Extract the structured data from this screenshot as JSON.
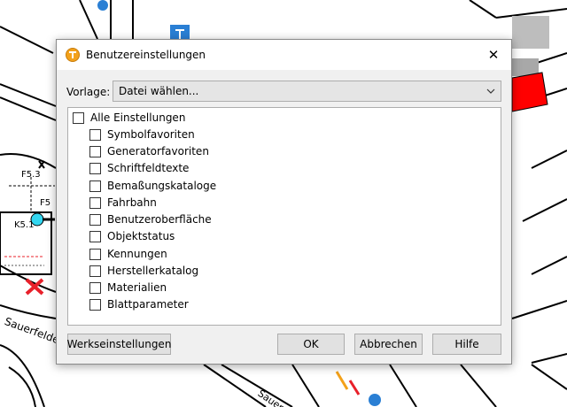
{
  "map": {
    "labels": [
      "F5.3",
      "F5",
      "K5.1",
      "Sauerfelde",
      "Sauer"
    ],
    "colors": {
      "red_block": "#ff0000",
      "grey_block": "#a8a8a8",
      "marker": "#33d6f0",
      "cross": "#e8202a",
      "sign": "#2a7fd4"
    }
  },
  "dialog": {
    "title": "Benutzereinstellungen",
    "app_icon": "app-logo-icon",
    "close_glyph": "✕",
    "vorlage_label": "Vorlage:",
    "vorlage_value": "Datei wählen...",
    "all_label": "Alle Einstellungen",
    "items": [
      "Symbolfavoriten",
      "Generatorfavoriten",
      "Schriftfeldtexte",
      "Bemaßungskataloge",
      "Fahrbahn",
      "Benutzeroberfläche",
      "Objektstatus",
      "Kennungen",
      "Herstellerkatalog",
      "Materialien",
      "Blattparameter"
    ],
    "buttons": {
      "factory": "Werkseinstellungen",
      "ok": "OK",
      "cancel": "Abbrechen",
      "help": "Hilfe"
    }
  }
}
